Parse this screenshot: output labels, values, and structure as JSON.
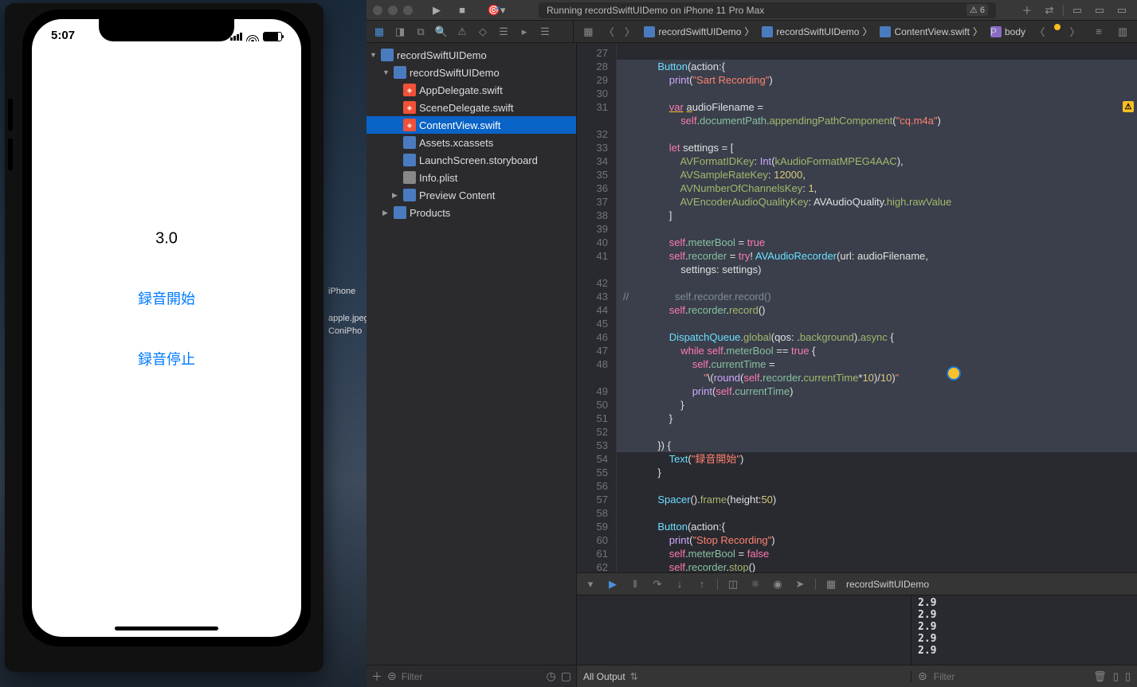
{
  "simulator": {
    "time": "5:07",
    "text_value": "3.0",
    "button_start": "録音開始",
    "button_stop": "録音停止",
    "desktop_file1": "iPhone",
    "desktop_file2": "apple.jpeg",
    "desktop_file3": "ConiPho"
  },
  "toolbar": {
    "status": "Running recordSwiftUIDemo on iPhone 11 Pro Max",
    "warnings": "6"
  },
  "navigator": {
    "filter_placeholder": "Filter",
    "tree": {
      "project": "recordSwiftUIDemo",
      "group": "recordSwiftUIDemo",
      "files": {
        "f0": "AppDelegate.swift",
        "f1": "SceneDelegate.swift",
        "f2": "ContentView.swift",
        "f3": "Assets.xcassets",
        "f4": "LaunchScreen.storyboard",
        "f5": "Info.plist",
        "f6": "Preview Content"
      },
      "products": "Products"
    }
  },
  "jump": {
    "p0": "recordSwiftUIDemo",
    "p1": "recordSwiftUIDemo",
    "p2": "ContentView.swift",
    "p3": "body"
  },
  "code": {
    "lines": {
      "27": "",
      "28": "            Button(action:{",
      "29": "                print(\"Sart Recording\")",
      "30": "                ",
      "31": "                var audioFilename =",
      "31b": "                    self.documentPath.appendingPathComponent(\"cq.m4a\")",
      "32": "                ",
      "33": "                let settings = [",
      "34": "                    AVFormatIDKey: Int(kAudioFormatMPEG4AAC),",
      "35": "                    AVSampleRateKey: 12000,",
      "36": "                    AVNumberOfChannelsKey: 1,",
      "37": "                    AVEncoderAudioQualityKey: AVAudioQuality.high.rawValue",
      "38": "                ]",
      "39": "                ",
      "40": "                self.meterBool = true",
      "41": "                self.recorder = try! AVAudioRecorder(url: audioFilename,",
      "41b": "                    settings: settings)",
      "42": "",
      "43": "//                self.recorder.record()",
      "44": "                self.recorder.record()",
      "45": "                ",
      "46": "                DispatchQueue.global(qos: .background).async {",
      "47": "                    while self.meterBool == true {",
      "48": "                        self.currentTime =",
      "48b": "                            \"\\(round(self.recorder.currentTime*10)/10)\"",
      "49": "                        print(self.currentTime)",
      "50": "                    }",
      "51": "                }",
      "52": "                ",
      "53": "            }) {",
      "54": "                Text(\"録音開始\")",
      "55": "            }",
      "56": "            ",
      "57": "            Spacer().frame(height:50)",
      "58": "            ",
      "59": "            Button(action:{",
      "60": "                print(\"Stop Recording\")",
      "61": "                self.meterBool = false",
      "62": "                self.recorder.stop()"
    }
  },
  "debug": {
    "target": "recordSwiftUIDemo",
    "output_mode": "All Output",
    "filter_placeholder": "Filter",
    "console": "2.9\n2.9\n2.9\n2.9\n2.9"
  }
}
